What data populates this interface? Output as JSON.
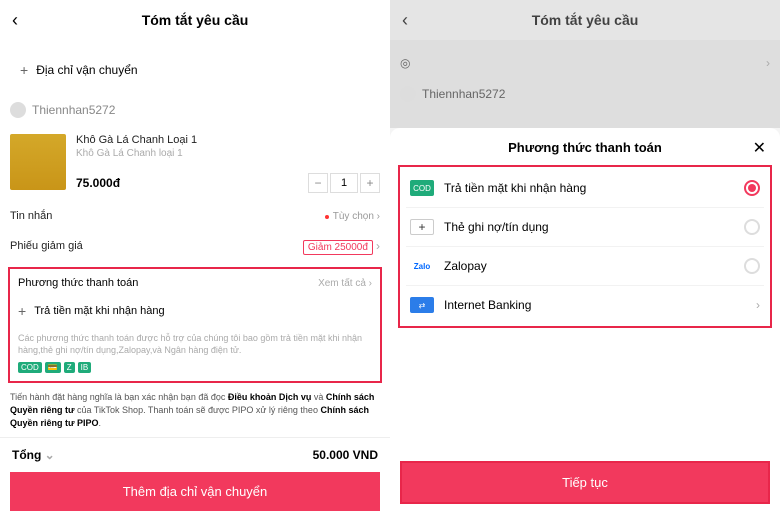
{
  "left": {
    "header_title": "Tóm tắt yêu cầu",
    "address_add": "Địa chỉ vận chuyển",
    "username": "Thiennhan5272",
    "product_name": "Khô Gà Lá Chanh Loại 1",
    "product_sub": "Khô Gà Lá Chanh loại 1",
    "price": "75.000đ",
    "qty": "1",
    "message_label": "Tin nhắn",
    "message_opt": "Tùy chọn",
    "coupon_label": "Phiếu giảm giá",
    "coupon_val": "Giảm 25000đ",
    "payment_title": "Phương thức thanh toán",
    "payment_all": "Xem tất cả",
    "payment_add": "Trả tiền mặt khi nhận hàng",
    "disclaimer": "Các phương thức thanh toán được hỗ trợ của chúng tôi bao gồm trả tiền mặt khi nhận hàng,thẻ ghi nợ/tín dụng,Zalopay,và Ngân hàng điện tử.",
    "terms_pre": "Tiến hành đặt hàng nghĩa là bạn xác nhận bạn đã đọc ",
    "terms_b1": "Điều khoản Dịch vụ",
    "terms_mid1": " và ",
    "terms_b2": "Chính sách Quyền riêng tư",
    "terms_mid2": " của TikTok Shop. Thanh toán sẽ được PIPO xử lý riêng theo ",
    "terms_b3": "Chính sách Quyền riêng tư PIPO",
    "terms_end": ".",
    "total_label": "Tổng",
    "total_val": "50.000 VND",
    "cta": "Thêm địa chỉ vận chuyển"
  },
  "right": {
    "header_title": "Tóm tắt yêu cầu",
    "dim_username": "Thiennhan5272",
    "sheet_title": "Phương thức thanh toán",
    "items": [
      {
        "name": "Trả tiền mặt khi nhận hàng"
      },
      {
        "name": "Thẻ ghi nợ/tín dụng"
      },
      {
        "name": "Zalopay"
      },
      {
        "name": "Internet Banking"
      }
    ],
    "cta": "Tiếp tục"
  }
}
